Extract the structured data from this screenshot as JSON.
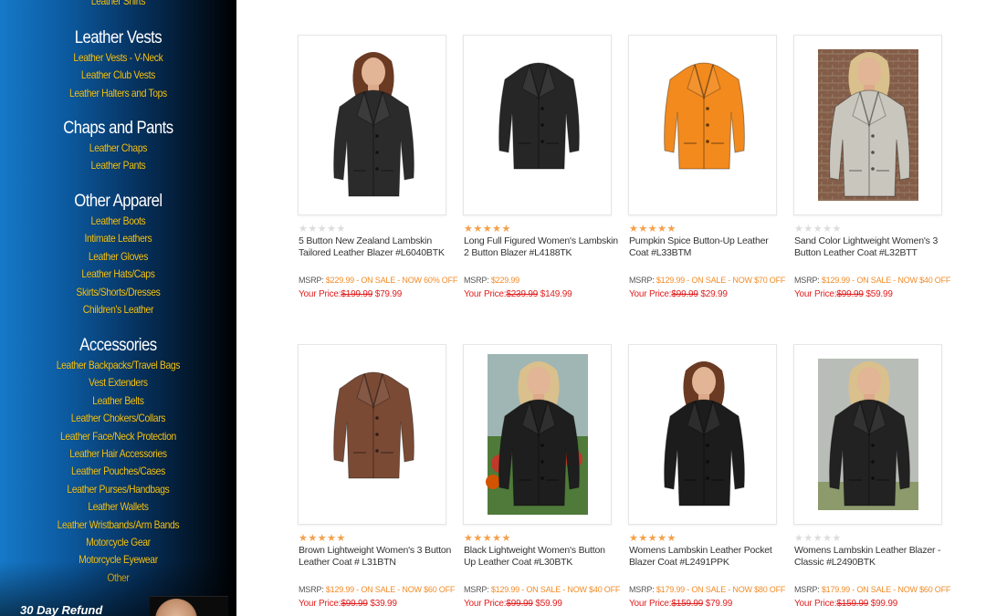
{
  "sidebar": {
    "top_link": "Leather Shirts",
    "groups": [
      {
        "heading": "Leather Vests",
        "links": [
          "Leather Vests - V-Neck",
          "Leather Club Vests",
          "Leather Halters and Tops"
        ]
      },
      {
        "heading": "Chaps and Pants",
        "links": [
          "Leather Chaps",
          "Leather Pants"
        ]
      },
      {
        "heading": "Other Apparel",
        "links": [
          "Leather Boots",
          "Intimate Leathers",
          "Leather Gloves",
          "Leather Hats/Caps",
          "Skirts/Shorts/Dresses",
          "Children's Leather"
        ]
      },
      {
        "heading": "Accessories",
        "links": [
          "Leather Backpacks/Travel Bags",
          "Vest Extenders",
          "Leather Belts",
          "Leather Chokers/Collars",
          "Leather Face/Neck Protection",
          "Leather Hair Accessories",
          "Leather Pouches/Cases",
          "Leather Purses/Handbags",
          "Leather Wallets",
          "Leather Wristbands/Arm Bands",
          "Motorcycle Gear",
          "Motorcycle Eyewear",
          "Other"
        ]
      }
    ],
    "refund_text": "30 Day Refund"
  },
  "labels": {
    "msrp": "MSRP:",
    "your_price": "Your Price:"
  },
  "colors": {
    "link_yellow": "#f5c518",
    "star_on": "#f5a04a",
    "sale_orange": "#f28c28",
    "price_red": "#e02020"
  },
  "products": [
    {
      "name": "5 Button New Zealand Lambskin Tailored Leather Blazer #L6040BTK",
      "rating": 0,
      "msrp": "$229.99",
      "sale": "- ON SALE - NOW 60% OFF",
      "old_price": "$199.99",
      "price": "$79.99",
      "jacket_color": "#2b2b2b",
      "photo": "model"
    },
    {
      "name": "Long Full Figured Women's Lambskin 2 Button Blazer #L4188TK",
      "rating": 5,
      "msrp": "$229.99",
      "sale": "",
      "old_price": "$239.99",
      "price": "$149.99",
      "jacket_color": "#262626",
      "photo": "flat"
    },
    {
      "name": "Pumpkin Spice Button-Up Leather Coat #L33BTM",
      "rating": 5,
      "msrp": "$129.99",
      "sale": "- ON SALE - NOW $70 OFF",
      "old_price": "$99.99",
      "price": "$29.99",
      "jacket_color": "#f28a1e",
      "photo": "flat"
    },
    {
      "name": "Sand Color Lightweight Women's 3 Button Leather Coat #L32BTT",
      "rating": 0,
      "msrp": "$129.99",
      "sale": "- ON SALE - NOW $40 OFF",
      "old_price": "$99.99",
      "price": "$59.99",
      "jacket_color": "#c9c6bd",
      "photo": "outdoor"
    },
    {
      "name": "Brown Lightweight Women's 3 Button Leather Coat # L31BTN",
      "rating": 5,
      "msrp": "$129.99",
      "sale": "- ON SALE - NOW $60 OFF",
      "old_price": "$99.99",
      "price": "$39.99",
      "jacket_color": "#7a4a35",
      "photo": "flat"
    },
    {
      "name": "Black Lightweight Women's Button Up Leather Coat #L30BTK",
      "rating": 5,
      "msrp": "$129.99",
      "sale": "- ON SALE - NOW $40 OFF",
      "old_price": "$99.99",
      "price": "$59.99",
      "jacket_color": "#1e1e1e",
      "photo": "garden"
    },
    {
      "name": "Womens Lambskin Leather Pocket Blazer Coat #L2491PPK",
      "rating": 5,
      "msrp": "$179.99",
      "sale": "- ON SALE - NOW $80 OFF",
      "old_price": "$159.99",
      "price": "$79.99",
      "jacket_color": "#1c1c1c",
      "photo": "model"
    },
    {
      "name": "Womens Lambskin Leather Blazer - Classic #L2490BTK",
      "rating": 0,
      "msrp": "$179.99",
      "sale": "- ON SALE - NOW $60 OFF",
      "old_price": "$159.99",
      "price": "$99.99",
      "jacket_color": "#222222",
      "photo": "outdoor-bw"
    }
  ]
}
